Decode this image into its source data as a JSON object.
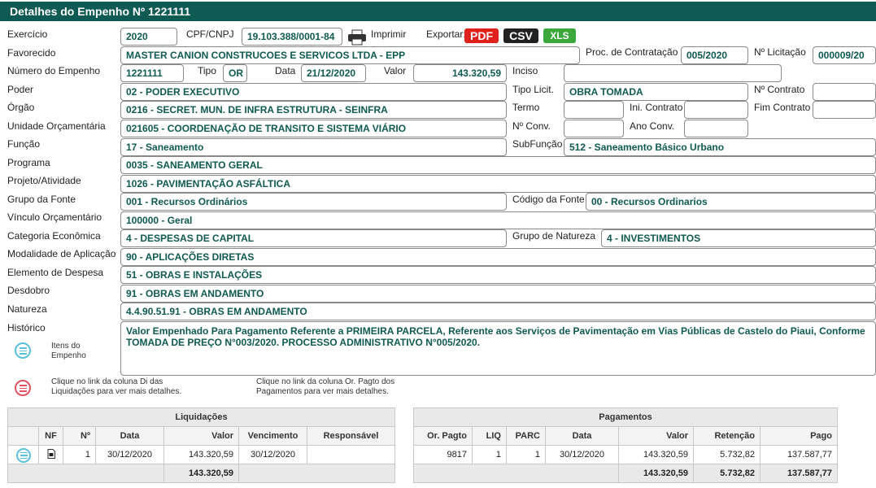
{
  "header": {
    "title": "Detalhes do Empenho Nº 1221111"
  },
  "fields": {
    "exercicio": {
      "label": "Exercício",
      "value": "2020"
    },
    "cpf_cnpj": {
      "label": "CPF/CNPJ",
      "value": "19.103.388/0001-84"
    },
    "imprimir_label": "Imprimir",
    "exportar_label": "Exportar:",
    "export_pdf": "PDF",
    "export_csv": "CSV",
    "export_xls": "XLS",
    "favorecido": {
      "label": "Favorecido",
      "value": "MASTER CANION CONSTRUCOES E SERVICOS LTDA - EPP"
    },
    "proc_contratacao": {
      "label": "Proc. de Contratação",
      "value": "005/2020"
    },
    "n_licitacao": {
      "label": "Nº Licitação",
      "value": "000009/20"
    },
    "numero_empenho": {
      "label": "Número do Empenho",
      "value": "1221111"
    },
    "tipo": {
      "label": "Tipo",
      "value": "OR"
    },
    "data": {
      "label": "Data",
      "value": "21/12/2020"
    },
    "valor": {
      "label": "Valor",
      "value": "143.320,59"
    },
    "inciso": {
      "label": "Inciso",
      "value": ""
    },
    "poder": {
      "label": "Poder",
      "value": "02 - PODER EXECUTIVO"
    },
    "tipo_licit": {
      "label": "Tipo Licit.",
      "value": "OBRA TOMADA"
    },
    "n_contrato": {
      "label": "Nº Contrato",
      "value": ""
    },
    "orgao": {
      "label": "Órgão",
      "value": "0216 - SECRET. MUN. DE INFRA ESTRUTURA - SEINFRA"
    },
    "termo": {
      "label": "Termo",
      "value": ""
    },
    "ini_contrato": {
      "label": "Ini. Contrato",
      "value": ""
    },
    "fim_contrato": {
      "label": "Fim Contrato",
      "value": ""
    },
    "unidade": {
      "label": "Unidade Orçamentária",
      "value": "021605 - COORDENAÇÃO DE TRANSITO E SISTEMA VIÁRIO"
    },
    "n_conv": {
      "label": "Nº Conv.",
      "value": ""
    },
    "ano_conv": {
      "label": "Ano Conv.",
      "value": ""
    },
    "funcao": {
      "label": "Função",
      "value": "17 - Saneamento"
    },
    "subfuncao": {
      "label": "SubFunção",
      "value": "512 - Saneamento Básico Urbano"
    },
    "programa": {
      "label": "Programa",
      "value": "0035 - SANEAMENTO GERAL"
    },
    "projeto": {
      "label": "Projeto/Atividade",
      "value": "1026 - PAVIMENTAÇÃO ASFÁLTICA"
    },
    "grupo_fonte": {
      "label": "Grupo da Fonte",
      "value": "001 - Recursos Ordinários"
    },
    "codigo_fonte": {
      "label": "Código da Fonte",
      "value": "00 - Recursos Ordinarios"
    },
    "vinculo": {
      "label": "Vínculo Orçamentário",
      "value": "100000 - Geral"
    },
    "categoria": {
      "label": "Categoria Econômica",
      "value": "4 - DESPESAS DE CAPITAL"
    },
    "grupo_natureza": {
      "label": "Grupo de Natureza",
      "value": "4 - INVESTIMENTOS"
    },
    "modalidade": {
      "label": "Modalidade de Aplicação",
      "value": "90 - APLICAÇÕES DIRETAS"
    },
    "elemento": {
      "label": "Elemento de Despesa",
      "value": "51 - OBRAS E INSTALAÇÕES"
    },
    "desdobro": {
      "label": "Desdobro",
      "value": "91 - OBRAS EM ANDAMENTO"
    },
    "natureza": {
      "label": "Natureza",
      "value": "4.4.90.51.91 - OBRAS EM ANDAMENTO"
    },
    "historico": {
      "label": "Histórico",
      "value": "Valor Empenhado Para Pagamento Referente a PRIMEIRA PARCELA, Referente aos Serviços de Pavimentação em Vias Públicas de Castelo do Piaui, Conforme TOMADA DE PREÇO N°003/2020. PROCESSO ADMINISTRATIVO N°005/2020."
    }
  },
  "notes": {
    "itens_empenho": "Itens do Empenho",
    "note_liquidacoes": "Clique no link da coluna Di das Liquidações para ver mais detalhes.",
    "note_pagamentos": "Clique no link da coluna Or. Pagto dos Pagamentos para ver mais detalhes."
  },
  "colors": {
    "header": "#0f5a52",
    "value_text": "#0f5a52",
    "pdf": "#e0201b",
    "csv": "#222222",
    "xls": "#3aa83a"
  },
  "liquidacoes": {
    "title": "Liquidações",
    "columns": [
      "NF",
      "Nº",
      "Data",
      "Valor",
      "Vencimento",
      "Responsável"
    ],
    "rows": [
      {
        "nf": "",
        "n": "1",
        "data": "30/12/2020",
        "valor": "143.320,59",
        "vencimento": "30/12/2020",
        "responsavel": ""
      }
    ],
    "total": "143.320,59"
  },
  "pagamentos": {
    "title": "Pagamentos",
    "columns": [
      "Or. Pagto",
      "LIQ",
      "PARC",
      "Data",
      "Valor",
      "Retenção",
      "Pago"
    ],
    "rows": [
      {
        "or_pagto": "9817",
        "liq": "1",
        "parc": "1",
        "data": "30/12/2020",
        "valor": "143.320,59",
        "retencao": "5.732,82",
        "pago": "137.587,77"
      }
    ],
    "total_valor": "143.320,59",
    "total_retencao": "5.732,82",
    "total_pago": "137.587,77"
  }
}
